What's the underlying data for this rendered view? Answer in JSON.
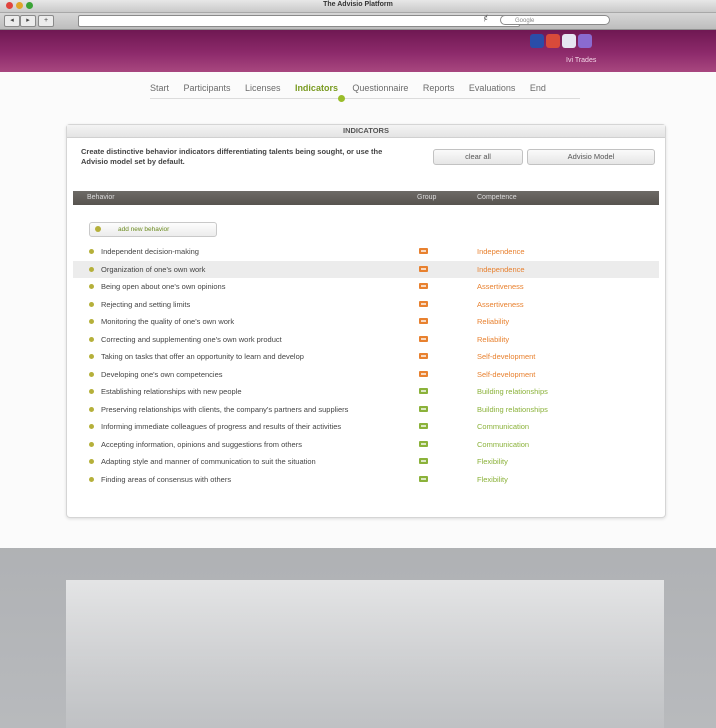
{
  "window": {
    "title": "The Advisio Platform"
  },
  "toolbar": {
    "back": "◂",
    "forward": "▸",
    "add": "+",
    "reload": "ȼ",
    "search_placeholder": "Google"
  },
  "header": {
    "user": "Ivi Trades"
  },
  "nav": {
    "tabs": [
      "Start",
      "Participants",
      "Licenses",
      "Indicators",
      "Questionnaire",
      "Reports",
      "Evaluations",
      "End"
    ],
    "active": "Indicators"
  },
  "panel": {
    "title": "INDICATORS",
    "description": "Create distinctive behavior indicators differentiating talents being sought, or use the Advisio model set by default.",
    "clear_all": "clear all",
    "advisio_model": "Advisio Model"
  },
  "table": {
    "headers": {
      "behavior": "Behavior",
      "group": "Group",
      "competence": "Competence"
    },
    "add_label": "add new behavior",
    "rows": [
      {
        "behavior": "Independent decision-making",
        "competence": "Independence",
        "color": "#e8812f"
      },
      {
        "behavior": "Organization of one's own work",
        "competence": "Independence",
        "color": "#e8812f",
        "highlight": true
      },
      {
        "behavior": "Being open about one's own opinions",
        "competence": "Assertiveness",
        "color": "#e8812f"
      },
      {
        "behavior": "Rejecting and setting limits",
        "competence": "Assertiveness",
        "color": "#e8812f"
      },
      {
        "behavior": "Monitoring the quality of one's own work",
        "competence": "Reliability",
        "color": "#e8812f"
      },
      {
        "behavior": "Correcting and supplementing one's own work product",
        "competence": "Reliability",
        "color": "#e8812f"
      },
      {
        "behavior": "Taking on tasks that offer an opportunity to learn and develop",
        "competence": "Self-development",
        "color": "#e8812f"
      },
      {
        "behavior": "Developing one's own competencies",
        "competence": "Self-development",
        "color": "#e8812f"
      },
      {
        "behavior": "Establishing relationships with new people",
        "competence": "Building relationships",
        "color": "#8bb23a"
      },
      {
        "behavior": "Preserving relationships with clients, the company's partners and suppliers",
        "competence": "Building relationships",
        "color": "#8bb23a"
      },
      {
        "behavior": "Informing immediate colleagues of progress and results of their activities",
        "competence": "Communication",
        "color": "#8bb23a"
      },
      {
        "behavior": "Accepting information, opinions and suggestions from others",
        "competence": "Communication",
        "color": "#8bb23a"
      },
      {
        "behavior": "Adapting style and manner of communication to suit the situation",
        "competence": "Flexibility",
        "color": "#8bb23a"
      },
      {
        "behavior": "Finding areas of consensus with others",
        "competence": "Flexibility",
        "color": "#8bb23a"
      }
    ]
  }
}
